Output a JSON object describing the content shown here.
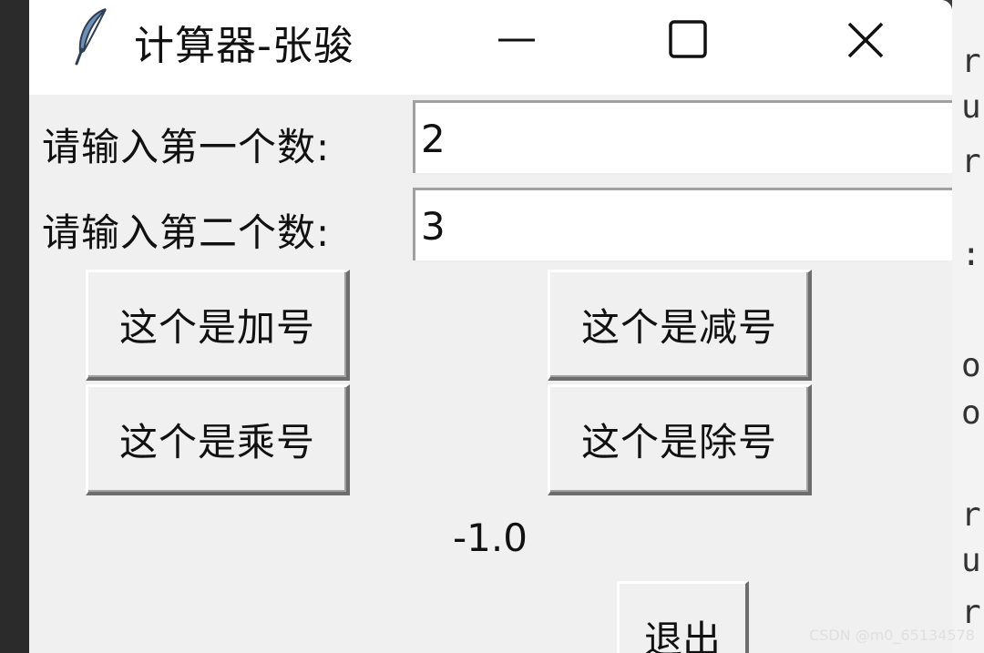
{
  "window": {
    "title": "计算器-张骏",
    "icon": "feather-icon",
    "controls": [
      "minimize-icon",
      "maximize-icon",
      "close-icon"
    ]
  },
  "form": {
    "first_label": "请输入第一个数:",
    "first_value": "2",
    "second_label": "请输入第二个数:",
    "second_value": "3"
  },
  "buttons": {
    "add": "这个是加号",
    "subtract": "这个是减号",
    "multiply": "这个是乘号",
    "divide": "这个是除号",
    "exit": "退出"
  },
  "result": "-1.0",
  "background_editor": {
    "chars": [
      "r",
      "u",
      "r",
      ":",
      "o",
      "o",
      "r",
      "u",
      "r"
    ]
  },
  "watermark": "CSDN @m0_65134578"
}
